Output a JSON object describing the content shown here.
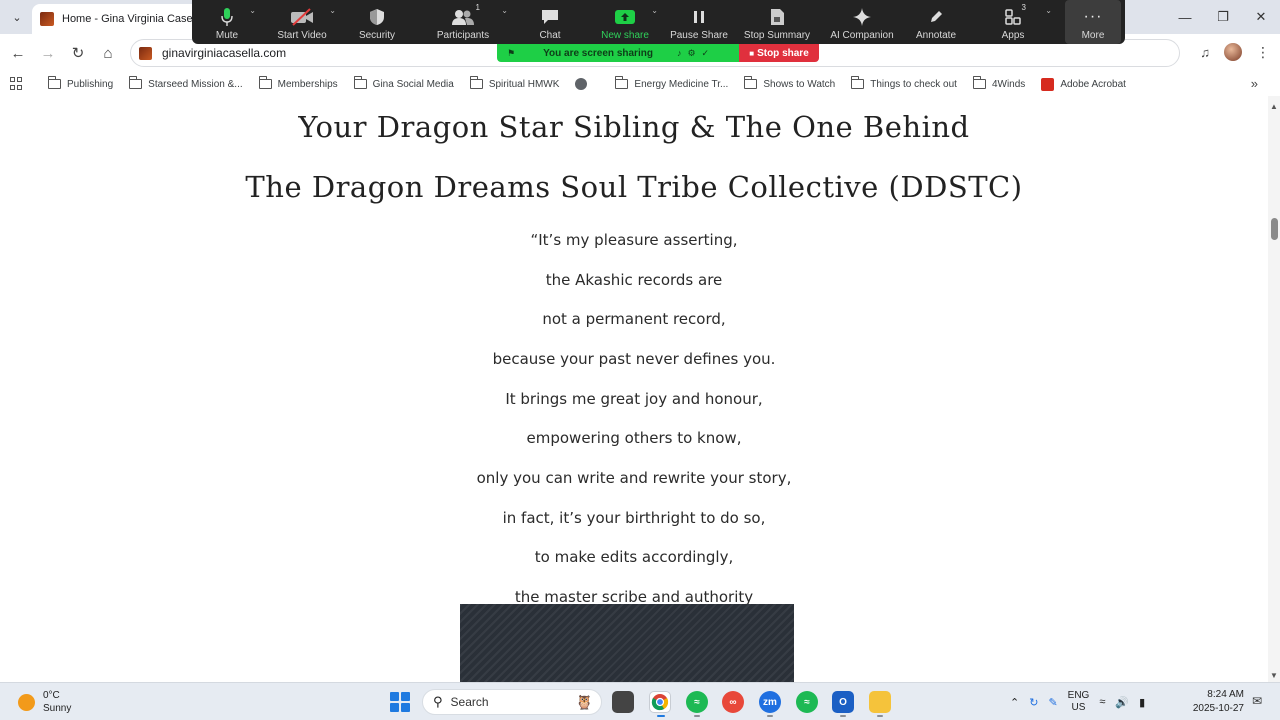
{
  "browser": {
    "tab_title": "Home - Gina Virginia Casella",
    "url": "ginavirginiacasella.com",
    "icons": [
      "tab-menu-icon",
      "back-icon",
      "forward-icon",
      "reload-icon",
      "home-icon",
      "media-control-icon",
      "profile-avatar",
      "kebab-menu-icon"
    ]
  },
  "bookmarks": [
    {
      "label": "Publishing",
      "icon": "folder-icon"
    },
    {
      "label": "Starseed Mission &...",
      "icon": "folder-icon"
    },
    {
      "label": "Memberships",
      "icon": "folder-icon"
    },
    {
      "label": "Gina Social Media",
      "icon": "folder-icon"
    },
    {
      "label": "Spiritual HMWK",
      "icon": "folder-icon"
    },
    {
      "label": "",
      "icon": "globe-icon"
    },
    {
      "label": "Energy Medicine Tr...",
      "icon": "folder-icon"
    },
    {
      "label": "Shows to Watch",
      "icon": "folder-icon"
    },
    {
      "label": "Things to check out",
      "icon": "folder-icon"
    },
    {
      "label": "4Winds",
      "icon": "folder-icon"
    },
    {
      "label": "Adobe Acrobat",
      "icon": "acrobat-icon"
    }
  ],
  "zoom": {
    "mute": "Mute",
    "start_video": "Start Video",
    "security": "Security",
    "participants": "Participants",
    "participants_count": "1",
    "chat": "Chat",
    "new_share": "New share",
    "pause_share": "Pause Share",
    "stop_summary": "Stop Summary",
    "ai_companion": "AI Companion",
    "annotate": "Annotate",
    "apps": "Apps",
    "apps_count": "3",
    "more": "More",
    "sharing_text": "You are screen sharing",
    "stop_share": "Stop share",
    "accent_green": "#1ecf46",
    "stop_red": "#e0303d"
  },
  "page": {
    "heading_1": "Your Dragon Star Sibling & The One Behind",
    "heading_2": "The Dragon Dreams Soul Tribe Collective (DDSTC)",
    "quote_lines": [
      "“It’s my pleasure asserting,",
      "the Akashic records are",
      "not a permanent record,",
      "because your past never defines you.",
      "It brings me great joy and honour,",
      "empowering others to know,",
      "only you can write and rewrite your story,",
      "in fact, it’s your birthright to do so,",
      "to make edits accordingly,",
      "the master scribe and authority"
    ]
  },
  "taskbar": {
    "temperature": "0°C",
    "weather": "Sunny",
    "search_placeholder": "Search",
    "lang_1": "ENG",
    "lang_2": "US",
    "time": "8:24 AM",
    "date": "2025-10-27"
  }
}
